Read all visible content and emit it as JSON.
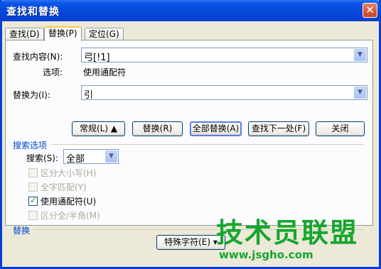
{
  "window": {
    "title": "查找和替换",
    "close_glyph": "✕"
  },
  "tabs": [
    {
      "label": "查找(D)",
      "active": false
    },
    {
      "label": "替换(P)",
      "active": true
    },
    {
      "label": "定位(G)",
      "active": false
    }
  ],
  "find": {
    "label": "查找内容(N):",
    "value": "弓[!1]"
  },
  "options": {
    "label": "选项:",
    "value": "使用通配符"
  },
  "replace": {
    "label": "替换为(I):",
    "value": "引"
  },
  "buttons": {
    "normal": "常规(L) ▲",
    "replace": "替换(R)",
    "replace_all": "全部替换(A)",
    "find_next": "查找下一处(F)",
    "close": "关闭"
  },
  "search_options": {
    "section_label": "搜索选项",
    "search_label": "搜索(S):",
    "search_value": "全部",
    "checkboxes": [
      {
        "label": "区分大小写(H)",
        "checked": false,
        "disabled": true
      },
      {
        "label": "全字匹配(Y)",
        "checked": false,
        "disabled": true
      },
      {
        "label": "使用通配符(U)",
        "checked": true,
        "disabled": false
      },
      {
        "label": "区分全/半角(M)",
        "checked": false,
        "disabled": true
      }
    ]
  },
  "replace_section": {
    "label": "替换",
    "special_button": "特殊字符(E) ▾"
  },
  "watermark": {
    "main": "技术员联盟",
    "url": "www.jsgho.com"
  },
  "colors": {
    "title_bar": "#0546D6",
    "section_label": "#0046D5",
    "watermark": "#16A62E"
  }
}
